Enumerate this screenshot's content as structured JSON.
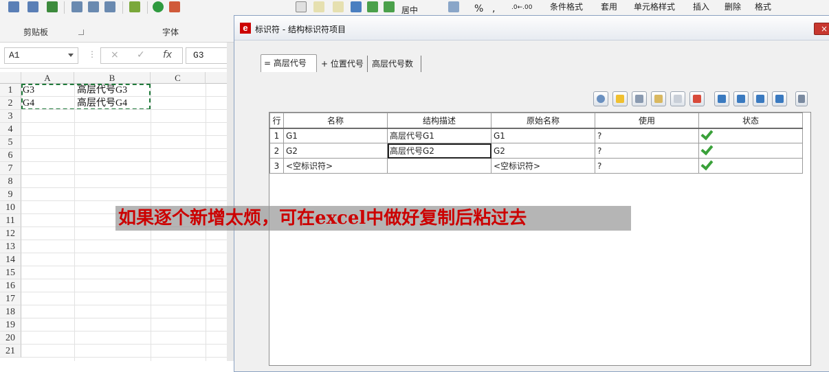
{
  "ribbon": {
    "clipboard_label": "剪贴板",
    "font_label": "字体",
    "align_center": "居中",
    "percent": "%",
    "comma": ",",
    "cond_format": "条件格式",
    "apply": "套用",
    "cell_style": "单元格样式",
    "insert": "插入",
    "delete": "删除",
    "format": "格式",
    "dec_inc": ".0←.00",
    "dec_dec": ".00→.0"
  },
  "formula_bar": {
    "name_box": "A1",
    "cancel_icon": "×",
    "confirm_icon": "✓",
    "fx_icon": "fx",
    "value": "G3"
  },
  "sheet": {
    "columns": [
      "A",
      "B",
      "C"
    ],
    "rows": [
      "1",
      "2",
      "3",
      "4",
      "5",
      "6",
      "7",
      "8",
      "9",
      "10",
      "11",
      "12",
      "13",
      "14",
      "15",
      "16",
      "17",
      "18",
      "19",
      "20",
      "21"
    ],
    "cells": [
      {
        "a": "G3",
        "b": "高层代号G3"
      },
      {
        "a": "G4",
        "b": "高层代号G4"
      }
    ]
  },
  "dialog": {
    "title": "标识符 - 结构标识符项目",
    "close_label": "×",
    "tabs": [
      "= 高层代号",
      "+ 位置代号",
      "高层代号数"
    ],
    "table": {
      "headers": [
        "行",
        "名称",
        "结构描述",
        "原始名称",
        "使用",
        "状态"
      ],
      "rows": [
        {
          "n": "1",
          "name": "G1",
          "desc": "高层代号G1",
          "orig": "G1",
          "use": "?",
          "ok": true
        },
        {
          "n": "2",
          "name": "G2",
          "desc": "高层代号G2",
          "orig": "G2",
          "use": "?",
          "ok": true
        },
        {
          "n": "3",
          "name": "<空标识符>",
          "desc": "",
          "orig": "<空标识符>",
          "use": "?",
          "ok": true
        }
      ]
    }
  },
  "caption": "如果逐个新增太烦，可在excel中做好复制后粘过去",
  "colors": {
    "accent": "#c00000",
    "check": "#3aa13a",
    "marquee": "#1f7a3a"
  }
}
